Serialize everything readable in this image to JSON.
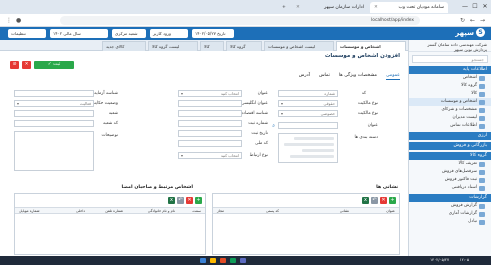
{
  "browser": {
    "tabs": [
      {
        "label": "سامانه مودیان تحت وب",
        "active": true
      },
      {
        "label": "ادارات سازمان سپهر",
        "active": false
      }
    ],
    "new_tab": "+",
    "window_buttons": [
      "—",
      "☐",
      "✕"
    ],
    "url": "localhost/app/index",
    "bookmarks": [
      "Imports",
      "Mail",
      "Drive"
    ]
  },
  "app": {
    "logo_text": "سپهر",
    "logo_mark": "S",
    "chips": [
      "۱۴۰۲/۰۵/۲۷ تاریخ",
      "ورود کاربر",
      "شعبه مرکزی",
      "سال مالی ۱۴۰۲",
      "تنظیمات"
    ]
  },
  "sidebar": {
    "header": "شرکت مهندسی داده سامان گستر پردازش نوین سپهر",
    "search_placeholder": "جستجو",
    "sections": [
      {
        "title": "اطلاعات پایه",
        "items": [
          "اشخاص",
          "گروه کالا",
          "کالا",
          "اشخاص و موسسات",
          "مشخصات و شرکای",
          "لیست مدیران",
          "اطلاعات تماس"
        ]
      },
      {
        "title": "ارزی",
        "items": []
      },
      {
        "title": "بازرگانی و فروش",
        "items": []
      },
      {
        "title": "گروه کالا",
        "items": [
          "تعریف کالا",
          "سرفصل‌های فروش",
          "ثبت فاکتور فروش",
          "اسناد دریافتنی"
        ]
      },
      {
        "title": "گزارشات",
        "items": [
          "گزارش فروش",
          "گزارشات آماری",
          "تبادل"
        ]
      }
    ]
  },
  "page_tabs": [
    "اشخاص و موسسات",
    "لیست اشخاص و موسسات",
    "گروه کالا",
    "کالا",
    "لیست گروه کالا",
    "کالای جدید"
  ],
  "page": {
    "title": "افزودن اشخاص و موسسات",
    "save_label": "✓ ثبت",
    "subtabs": [
      "عمومی",
      "مشخصات ویژگی ها",
      "تماس",
      "آدرس"
    ],
    "fields": {
      "code_label": "کد",
      "code_placeholder": "شماره",
      "name_label": "عنوان",
      "name_placeholder": "انتخاب کنید",
      "person_type_label": "نوع مالکیت",
      "person_type_value": "حقوقی",
      "latin_label": "عنوان انگلیسی",
      "economic_label": "شناسه اقتصادی",
      "national_label": "شناسه ملی",
      "reg_label": "شماره ثبت",
      "birth_label": "تاریخ ثبت",
      "father_label": "کد ملی",
      "nationality_label": "نوع ارتباط",
      "nationality_value": "انتخاب کنید",
      "ownership_label": "نوع مالکیت",
      "ownership_value": "خصوصی",
      "title_label": "عنوان",
      "tags_label": "دسته بندی ها",
      "phone_label": "شناسه آزمایه",
      "status_label": "وضعیت حکایت",
      "status_value": "فعالیت",
      "branch_label": "شعبه",
      "postal_label": "کد شعبه",
      "desc_label": "توضیحات"
    },
    "grid_right": {
      "title": "نشانی ها",
      "headers": [
        "عنوان",
        "نشانی",
        "کد پستی",
        "مجاز"
      ]
    },
    "grid_left": {
      "title": "اشخاص مرتبط و صاحبان امضا",
      "headers": [
        "سمت",
        "نام و نام خانوادگی",
        "شماره تلفن",
        "داخلی",
        "شماره موبایل"
      ]
    }
  },
  "taskbar": {
    "clock": "۱۲:۰۵",
    "date": "۱۴۰۲/۰۵/۲۷"
  },
  "colors": {
    "primary": "#1d6fb8",
    "save": "#2aa84a",
    "delete": "#e53935",
    "sidebar_header": "#2a7cc2"
  }
}
